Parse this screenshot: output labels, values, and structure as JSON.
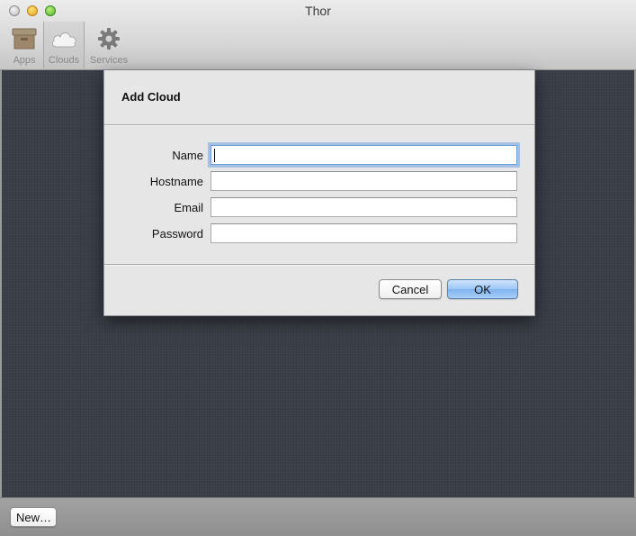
{
  "window": {
    "title": "Thor"
  },
  "toolbar": {
    "items": [
      {
        "label": "Apps",
        "icon": "box-icon"
      },
      {
        "label": "Clouds",
        "icon": "cloud-icon",
        "selected": true
      },
      {
        "label": "Services",
        "icon": "gear-icon"
      }
    ]
  },
  "dialog": {
    "title": "Add Cloud",
    "fields": [
      {
        "label": "Name",
        "value": "",
        "focused": true
      },
      {
        "label": "Hostname",
        "value": ""
      },
      {
        "label": "Email",
        "value": ""
      },
      {
        "label": "Password",
        "value": ""
      }
    ],
    "cancel_label": "Cancel",
    "ok_label": "OK"
  },
  "bottombar": {
    "new_label": "New…"
  },
  "colors": {
    "content_bg": "#3a3f48",
    "sheet_bg": "#e6e6e6",
    "focus_ring": "#6e9fd8",
    "ok_button": "#9ec6f5"
  }
}
